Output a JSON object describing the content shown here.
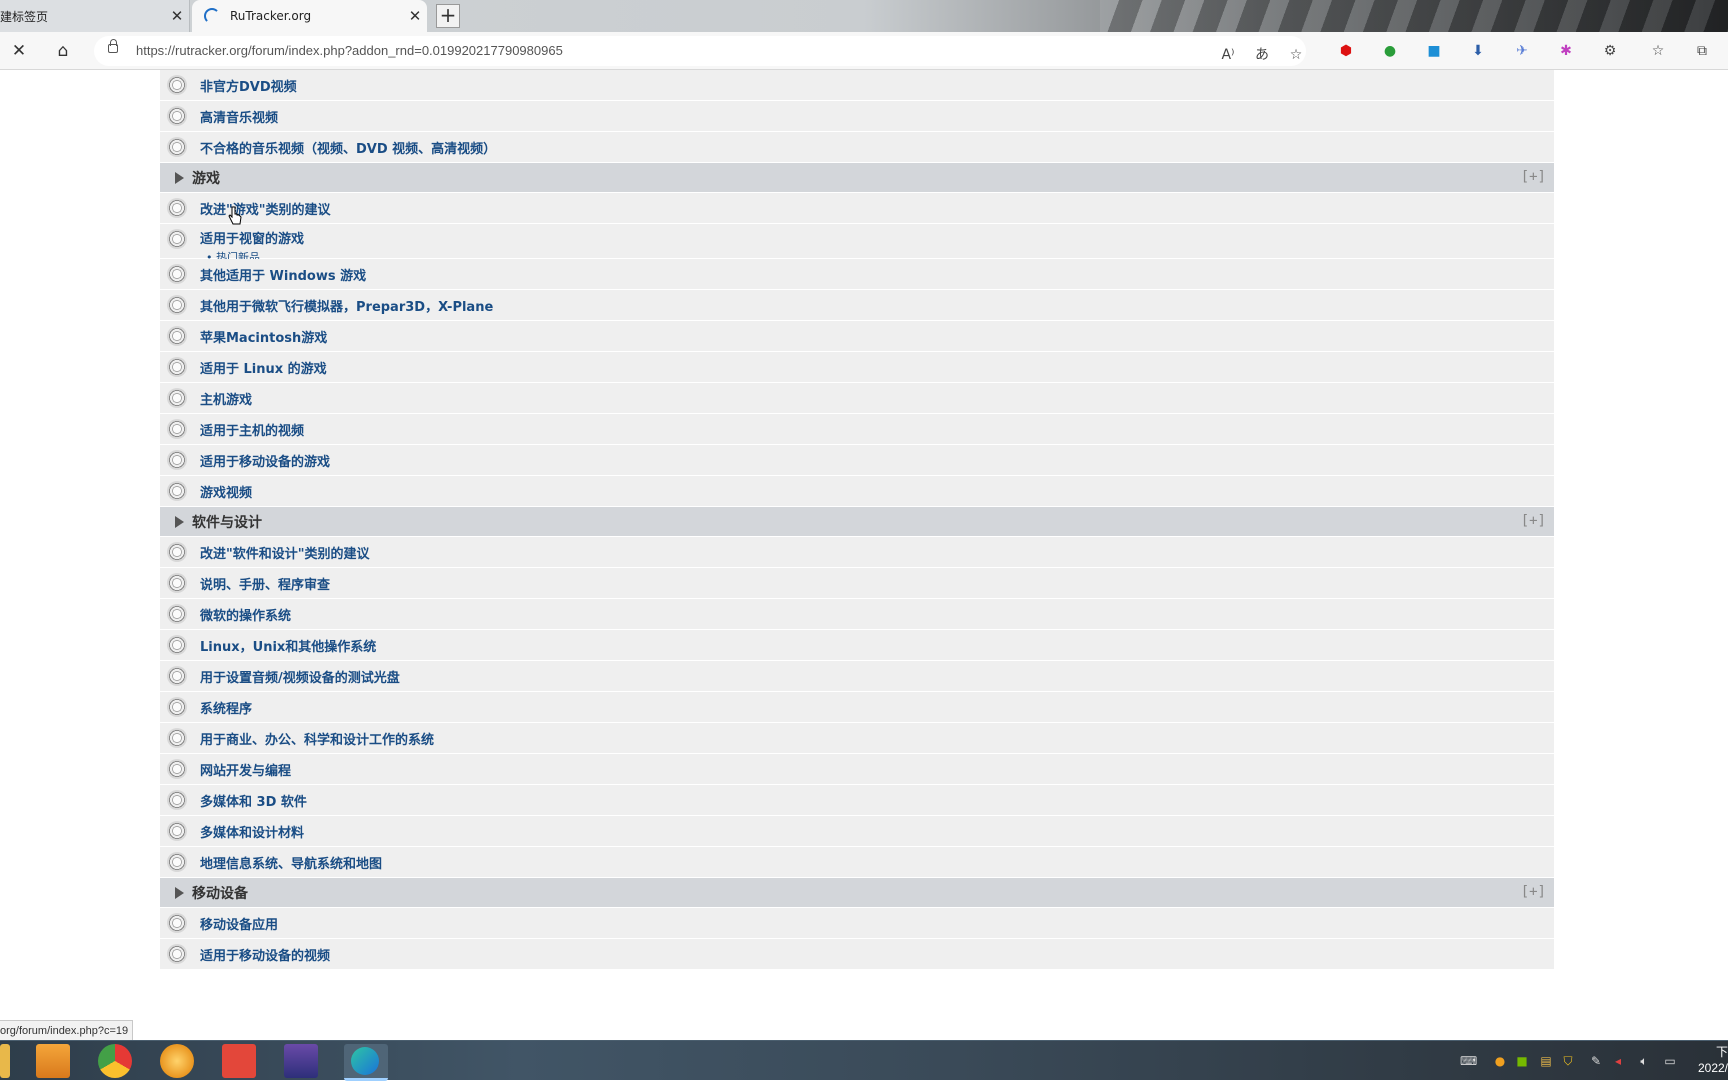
{
  "browser": {
    "tabs": [
      {
        "title": "建标签页",
        "active": false
      },
      {
        "title": "RuTracker.org",
        "active": true
      }
    ],
    "url": "https://rutracker.org/forum/index.php?addon_rnd=0.019920217790980965",
    "status_url": "org/forum/index.php?c=19",
    "toolbar_icons": [
      "read-aloud-icon",
      "translate-icon",
      "add-favorite-icon",
      "adblock-icon",
      "evernote-icon",
      "video-ext-icon",
      "download-ext-icon",
      "bird-ext-icon",
      "colorful-ext-icon",
      "extensions-icon",
      "favorites-icon",
      "collections-icon"
    ]
  },
  "forum": {
    "expand_label": "[+]",
    "sections": [
      {
        "title": null,
        "items": [
          {
            "label": "非官方DVD视频"
          },
          {
            "label": "高清音乐视频"
          },
          {
            "label": "不合格的音乐视频（视频、DVD 视频、高清视频）"
          }
        ]
      },
      {
        "title": "游戏",
        "items": [
          {
            "label": "改进\"游戏\"类别的建议"
          },
          {
            "label": "适用于视窗的游戏",
            "sub": "• 热门新品"
          },
          {
            "label": "其他适用于 Windows 游戏"
          },
          {
            "label": "其他用于微软飞行模拟器，Prepar3D，X-Plane"
          },
          {
            "label": "苹果Macintosh游戏"
          },
          {
            "label": "适用于 Linux 的游戏"
          },
          {
            "label": "主机游戏"
          },
          {
            "label": "适用于主机的视频"
          },
          {
            "label": "适用于移动设备的游戏"
          },
          {
            "label": "游戏视频"
          }
        ]
      },
      {
        "title": "软件与设计",
        "items": [
          {
            "label": "改进\"软件和设计\"类别的建议"
          },
          {
            "label": "说明、手册、程序审查"
          },
          {
            "label": "微软的操作系统"
          },
          {
            "label": "Linux，Unix和其他操作系统"
          },
          {
            "label": "用于设置音频/视频设备的测试光盘"
          },
          {
            "label": "系统程序"
          },
          {
            "label": "用于商业、办公、科学和设计工作的系统"
          },
          {
            "label": "网站开发与编程"
          },
          {
            "label": "多媒体和 3D 软件"
          },
          {
            "label": "多媒体和设计材料"
          },
          {
            "label": "地理信息系统、导航系统和地图"
          }
        ]
      },
      {
        "title": "移动设备",
        "items": [
          {
            "label": "移动设备应用"
          },
          {
            "label": "适用于移动设备的视频"
          }
        ]
      }
    ]
  },
  "taskbar": {
    "apps": [
      "file-explorer-icon",
      "media-player-icon",
      "chrome-icon",
      "orange-app-icon",
      "red-app-icon",
      "winrar-icon",
      "edge-icon"
    ],
    "clock_line1": "下",
    "clock_line2": "2022/"
  },
  "colors": {
    "link": "#1a4d85",
    "category_bg": "#d3d6da",
    "row_bg": "#efefef"
  }
}
